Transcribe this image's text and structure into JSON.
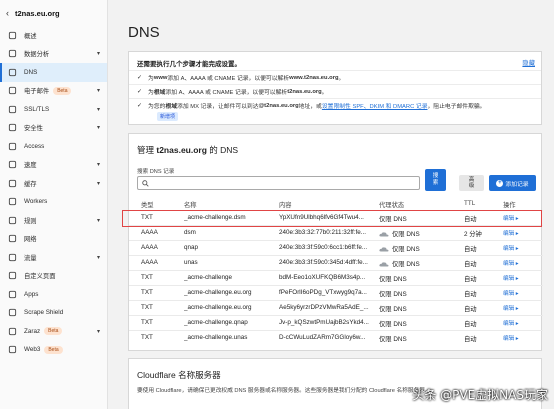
{
  "sidebar": {
    "back_icon": "chevron-left-icon",
    "domain": "t2nas.eu.org",
    "items": [
      {
        "label": "概述",
        "icon": "overview-icon"
      },
      {
        "label": "数据分析",
        "icon": "chart-icon",
        "chevron": "▾"
      },
      {
        "label": "DNS",
        "icon": "dns-icon",
        "active": true
      },
      {
        "label": "电子邮件",
        "icon": "mail-icon",
        "badge": "Beta",
        "chevron": "▾"
      },
      {
        "label": "SSL/TLS",
        "icon": "lock-icon",
        "chevron": "▾"
      },
      {
        "label": "安全性",
        "icon": "shield-icon",
        "chevron": "▾"
      },
      {
        "label": "Access",
        "icon": "access-icon"
      },
      {
        "label": "速度",
        "icon": "speed-icon",
        "chevron": "▾"
      },
      {
        "label": "缓存",
        "icon": "cache-icon",
        "chevron": "▾"
      },
      {
        "label": "Workers",
        "icon": "workers-icon"
      },
      {
        "label": "规则",
        "icon": "rules-icon",
        "chevron": "▾"
      },
      {
        "label": "网络",
        "icon": "network-icon"
      },
      {
        "label": "流量",
        "icon": "traffic-icon",
        "chevron": "▾"
      },
      {
        "label": "自定义页面",
        "icon": "page-icon"
      },
      {
        "label": "Apps",
        "icon": "apps-icon"
      },
      {
        "label": "Scrape Shield",
        "icon": "scrape-shield-icon"
      },
      {
        "label": "Zaraz",
        "icon": "zaraz-icon",
        "badge": "Beta",
        "chevron": "▾"
      },
      {
        "label": "Web3",
        "icon": "web3-icon",
        "badge": "Beta"
      }
    ]
  },
  "page": {
    "title": "DNS"
  },
  "notice": {
    "title": "还需要执行几个步骤才能完成设置。",
    "dismiss": "隐藏",
    "lines": [
      {
        "pre": "为 ",
        "bold1": "www",
        "mid": " 添加 A、AAAA 或 CNAME 记录，以便可以解析 ",
        "bold2": "www.t2nas.eu.org",
        "post": "。"
      },
      {
        "pre": "为 ",
        "bold1": "根域",
        "mid": " 添加 A、AAAA 或 CNAME 记录，以便可以解析 ",
        "bold2": "t2nas.eu.org",
        "post": "。"
      },
      {
        "pre": "为您的 ",
        "bold1": "根域",
        "mid": " 添加 MX 记录，让邮件可以到达 ",
        "bold2": "@t2nas.eu.org",
        "post": " 地址，或",
        "link": "设置限制性 SPF、DKIM 和 DMARC 记录",
        "tail": "，阻止电子邮件欺骗。"
      }
    ],
    "new_tag": "新增项"
  },
  "records": {
    "title_pre": "管理 ",
    "title_domain": "t2nas.eu.org",
    "title_post": " 的 DNS",
    "search_label": "搜索 DNS 记录",
    "search_placeholder": "",
    "search_button": "搜\n索",
    "advanced_button": "高\n级",
    "add_button": "添加记录",
    "columns": {
      "type": "类型",
      "name": "名称",
      "content": "内容",
      "proxy": "代理状态",
      "ttl": "TTL",
      "actions": "操作"
    },
    "rows": [
      {
        "type": "TXT",
        "name": "_acme-challenge.dsm",
        "content": "YpXUfn9Ulbhq6lfv6Gf4Twu4...",
        "proxy": "仅限 DNS",
        "ttl": "自动",
        "edit": "编辑 ▸",
        "cloud": false
      },
      {
        "type": "AAAA",
        "name": "dsm",
        "content": "240e:3b3:32:77b0:211:32ff:fe...",
        "proxy": "仅限 DNS",
        "ttl": "2 分钟",
        "edit": "编辑 ▸",
        "cloud": true
      },
      {
        "type": "AAAA",
        "name": "qnap",
        "content": "240e:3b3:3f:59c0:6cc1:b6ff:fe...",
        "proxy": "仅限 DNS",
        "ttl": "自动",
        "edit": "编辑 ▸",
        "cloud": true
      },
      {
        "type": "AAAA",
        "name": "unas",
        "content": "240e:3b3:3f:59c0:345d:4dff:fe...",
        "proxy": "仅限 DNS",
        "ttl": "自动",
        "edit": "编辑 ▸",
        "cloud": true
      },
      {
        "type": "TXT",
        "name": "_acme-challenge",
        "content": "bdM-Eeo1oXUFKQB6M3s4p...",
        "proxy": "仅限 DNS",
        "ttl": "自动",
        "edit": "编辑 ▸",
        "cloud": false
      },
      {
        "type": "TXT",
        "name": "_acme-challenge.eu.org",
        "content": "fPeFOrlI6oPDg_VTxwyg9q7a...",
        "proxy": "仅限 DNS",
        "ttl": "自动",
        "edit": "编辑 ▸",
        "cloud": false
      },
      {
        "type": "TXT",
        "name": "_acme-challenge.eu.org",
        "content": "Ae5ky6yrzrDPzVMwRa5AdE_...",
        "proxy": "仅限 DNS",
        "ttl": "自动",
        "edit": "编辑 ▸",
        "cloud": false
      },
      {
        "type": "TXT",
        "name": "_acme-challenge.qnap",
        "content": "Jv-p_kQSzwtPmUajbB2sYkd4...",
        "proxy": "仅限 DNS",
        "ttl": "自动",
        "edit": "编辑 ▸",
        "cloud": false
      },
      {
        "type": "TXT",
        "name": "_acme-challenge.unas",
        "content": "D-cCWuLudZARm7GGloy6w...",
        "proxy": "仅限 DNS",
        "ttl": "自动",
        "edit": "编辑 ▸",
        "cloud": false
      }
    ]
  },
  "nameservers": {
    "title": "Cloudflare 名称服务器",
    "desc": "要使用 Cloudflare，请确保已更改权威 DNS 服务器或名称服务器。这些服务器是我们分配的 Cloudflare 名称服务器。"
  },
  "watermark": "头条 @PVE虚拟NAS玩家",
  "colors": {
    "accent": "#1f6fd6",
    "highlight": "#e04545",
    "active_bg": "#dfeefb"
  }
}
